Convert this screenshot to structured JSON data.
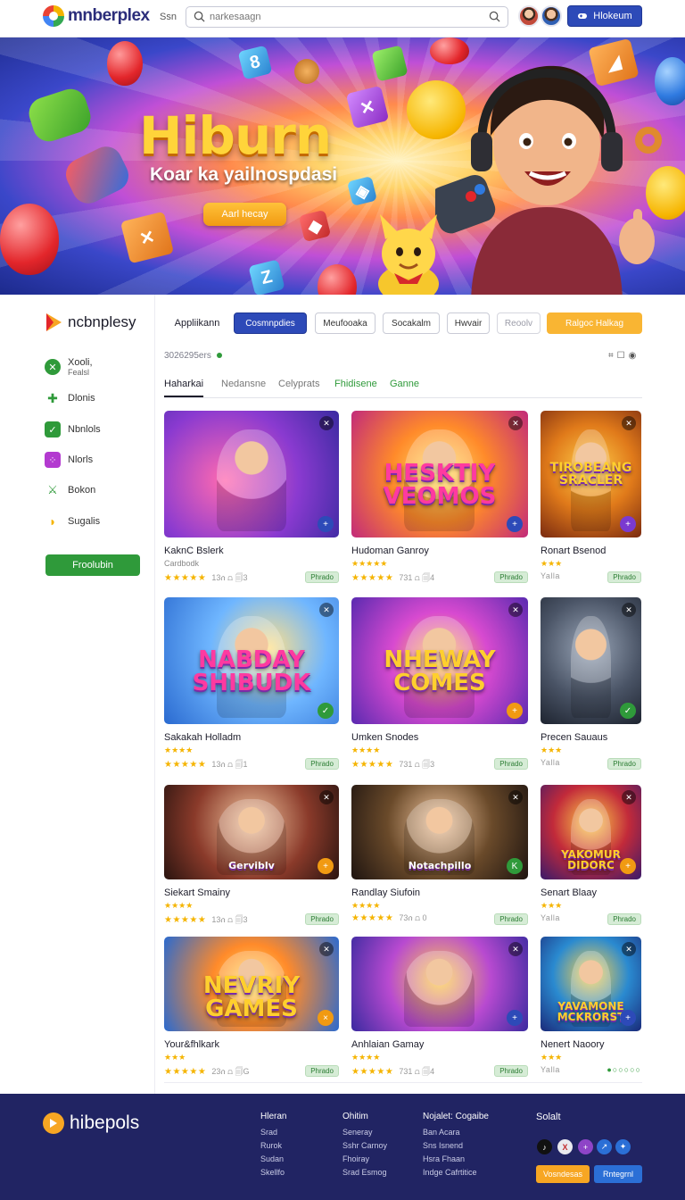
{
  "header": {
    "brand": "mnberplex",
    "link": "Ssn",
    "search_value": "",
    "search_placeholder": "narkesaagn",
    "signin_label": "Hlokeum"
  },
  "hero": {
    "title": "Hiburn",
    "subtitle": "Koar ka yailnospdasi",
    "cta": "Aarl hecay"
  },
  "sidebar": {
    "brand": "ncbnplesy",
    "items": [
      {
        "label": "Xooli,",
        "sublabel": "Fealsl",
        "icon": "gamepad-icon",
        "color": "#2f9a3a"
      },
      {
        "label": "Dlonis",
        "icon": "puzzle-icon",
        "color": "#2f9a3a"
      },
      {
        "label": "Nbnlols",
        "icon": "check-icon",
        "color": "#2f9a3a"
      },
      {
        "label": "Nlorls",
        "icon": "controller-icon",
        "color": "#b33ad0"
      },
      {
        "label": "Bokon",
        "icon": "sword-icon",
        "color": "#2f9a3a"
      },
      {
        "label": "Sugalis",
        "icon": "banana-icon",
        "color": "#f5b400"
      }
    ],
    "button": "Froolubin"
  },
  "filters": {
    "label": "Appliikann",
    "chips": [
      "Cosmnpdies",
      "Meufooaka",
      "Socakalm",
      "Hwvair",
      "Reoolv"
    ],
    "action": "Ralgoc Halkag"
  },
  "results": {
    "count": "3026295ers"
  },
  "tabs": [
    "Haharkai",
    "Nedansne",
    "Celyprats",
    "Fhidisene",
    "Ganne"
  ],
  "cards": [
    {
      "name": "KaknC Bslerk",
      "sub": "Cardbodk",
      "stars": "★★★★★",
      "meta": "13ሰ ⩍ 🗐3",
      "tag": "Phrado",
      "thumb_text": "",
      "badge": "+",
      "badge_color": "#2d4ab8"
    },
    {
      "name": "Hudoman Ganroy",
      "sub": "★★★★★",
      "stars": "★★★★★",
      "meta": "731 ⩍ 🗐4",
      "tag": "Phrado",
      "thumb_text": "HESKTIY VEOMOS",
      "badge": "+",
      "badge_color": "#2d4ab8"
    },
    {
      "name": "Ronart Bsenod",
      "sub": "★★★",
      "stars": "Yalla",
      "meta": "",
      "tag": "Phrado",
      "thumb_text": "TIROBEANG SRACLER",
      "badge": "+",
      "badge_color": "#7a3ad0"
    },
    {
      "name": "Sakakah Holladm",
      "sub": "★★★★",
      "stars": "★★★★★",
      "meta": "13ሰ ⩍ 🗐1",
      "tag": "Phrado",
      "thumb_text": "NABDAY SHIBUDK",
      "badge": "✓",
      "badge_color": "#2f9a3a"
    },
    {
      "name": "Umken Snodes",
      "sub": "★★★★",
      "stars": "★★★★★",
      "meta": "731 ⩍ 🗐3",
      "tag": "Phrado",
      "thumb_text": "NHEWAY COMES",
      "badge": "+",
      "badge_color": "#f19a12"
    },
    {
      "name": "Precen Sauaus",
      "sub": "★★★",
      "stars": "Yalla",
      "meta": "",
      "tag": "Phrado",
      "thumb_text": "",
      "badge": "✓",
      "badge_color": "#2f9a3a"
    },
    {
      "name": "Siekart Smainy",
      "sub": "★★★★",
      "stars": "★★★★★",
      "meta": "13ሰ ⩍ 🗐3",
      "tag": "Phrado",
      "thumb_text": "Gerviblv",
      "badge": "+",
      "badge_color": "#f19a12"
    },
    {
      "name": "Randlay Siufoin",
      "sub": "★★★★",
      "stars": "★★★★★",
      "meta": "73ሰ ⩍ 0",
      "tag": "Phrado",
      "thumb_text": "Notachpillo",
      "badge": "K",
      "badge_color": "#2f9a3a"
    },
    {
      "name": "Senart Blaay",
      "sub": "★★★",
      "stars": "Yalla",
      "meta": "",
      "tag": "Phrado",
      "thumb_text": "YAKOMUR DIDORC",
      "badge": "+",
      "badge_color": "#f19a12"
    },
    {
      "name": "Your&fhlkark",
      "sub": "★★★",
      "stars": "★★★★★",
      "meta": "23ሰ ⩍ 🗐G",
      "tag": "Phrado",
      "thumb_text": "NEVRIY GAMES",
      "badge": "×",
      "badge_color": "#f19a12"
    },
    {
      "name": "Anhlaian Gamay",
      "sub": "★★★★",
      "stars": "★★★★★",
      "meta": "731 ⩍ 🗐4",
      "tag": "Phrado",
      "thumb_text": "",
      "badge": "+",
      "badge_color": "#2d4ab8"
    },
    {
      "name": "Nenert Naoory",
      "sub": "★★★",
      "stars": "Yalla",
      "meta": "",
      "tag": "",
      "thumb_text": "YAVAMONE MCKRORST",
      "badge": "+",
      "badge_color": "#2d4ab8",
      "dots": "●○○○○○"
    }
  ],
  "footer": {
    "brand": "hibepols",
    "columns": [
      {
        "heading": "Hleran",
        "links": [
          "Srad",
          "Rurok",
          "Sudan",
          "Skellfo"
        ]
      },
      {
        "heading": "Ohitim",
        "links": [
          "Seneray",
          "Sshr Carnoy",
          "Fhoiray",
          "Srad Esmog"
        ]
      },
      {
        "heading": "Nojalet: Cogaibe",
        "links": [
          "Ban Acara",
          "Sns Isnend",
          "Hsra Fhaan",
          "Indge Cafrtitice"
        ]
      }
    ],
    "social_heading": "Solalt",
    "social": [
      {
        "icon": "tiktok-icon",
        "glyph": "♪",
        "color": "#111111"
      },
      {
        "icon": "x-icon",
        "glyph": "X",
        "color": "#e9e9ee"
      },
      {
        "icon": "plus-icon",
        "glyph": "+",
        "color": "#8e44c7"
      },
      {
        "icon": "share-icon",
        "glyph": "↗",
        "color": "#2b6fd6"
      },
      {
        "icon": "star-icon",
        "glyph": "✦",
        "color": "#2b6fd6"
      }
    ],
    "btn1": "Vosndesas",
    "btn2": "Rntegrnl"
  }
}
